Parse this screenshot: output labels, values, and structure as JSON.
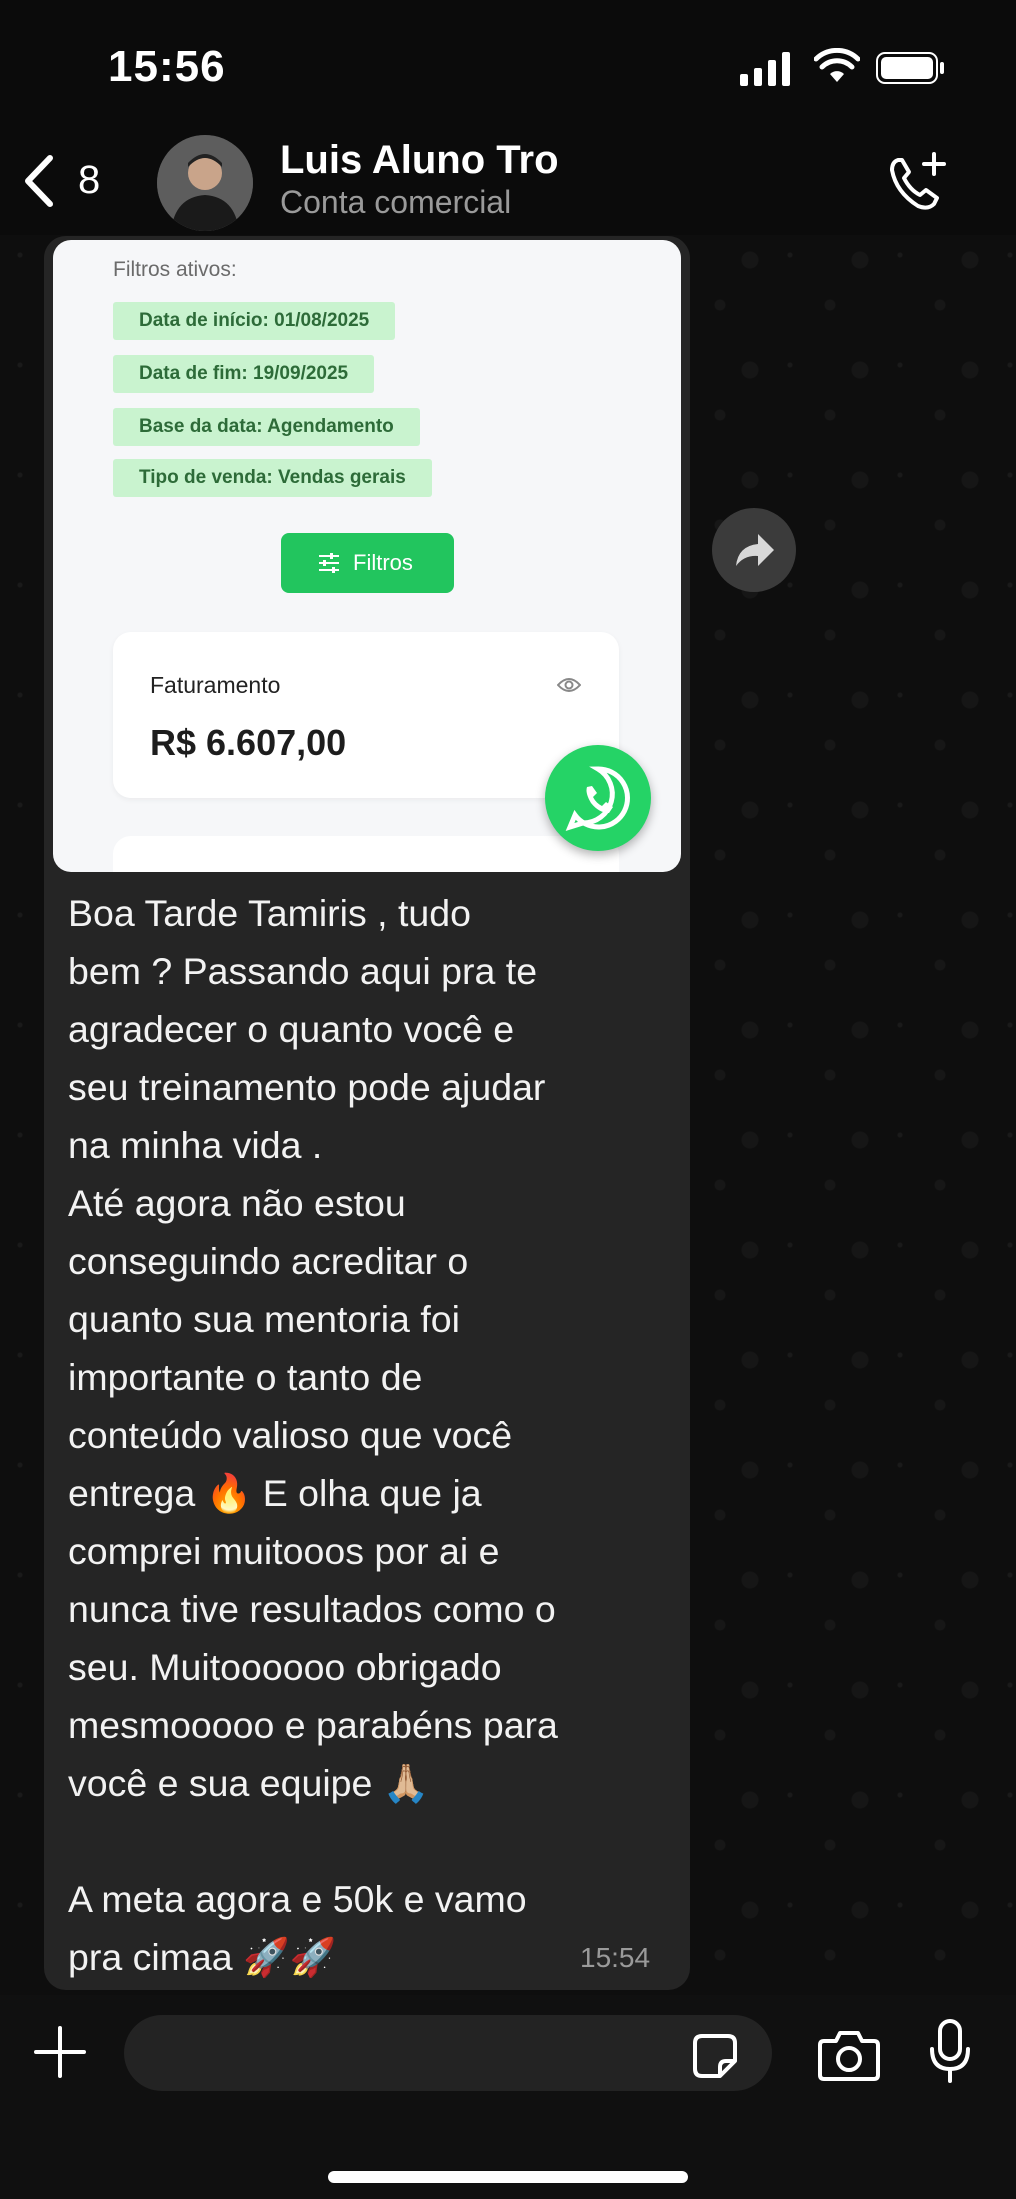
{
  "status_bar": {
    "time": "15:56"
  },
  "header": {
    "back_count": "8",
    "contact_name": "Luis Aluno Tro",
    "contact_subtitle": "Conta comercial"
  },
  "screenshot_card": {
    "filters_title": "Filtros ativos:",
    "chips": [
      "Data de início: 01/08/2025",
      "Data de fim: 19/09/2025",
      "Base da data: Agendamento",
      "Tipo de venda: Vendas gerais"
    ],
    "filters_button": "Filtros",
    "revenue_label": "Faturamento",
    "revenue_value": "R$ 6.607,00"
  },
  "message": {
    "text": "Boa Tarde Tamiris , tudo\nbem ? Passando aqui pra te\nagradecer o quanto você e\nseu treinamento pode ajudar\nna minha vida .\nAté agora não estou\nconseguindo acreditar o\nquanto sua mentoria foi\nimportante o tanto de\nconteúdo valioso que você\nentrega 🔥 E olha que ja\ncomprei muitooos por ai e\nnunca tive resultados como o\nseu. Muitoooooo obrigado\nmesmooooo e parabéns para\nvocê e sua equipe 🙏🏼\n\nA meta agora e 50k e vamo\npra cimaa 🚀🚀",
    "time": "15:54"
  },
  "colors": {
    "accent_green": "#22c55e",
    "whatsapp_green": "#25d366",
    "bubble": "#252525"
  }
}
